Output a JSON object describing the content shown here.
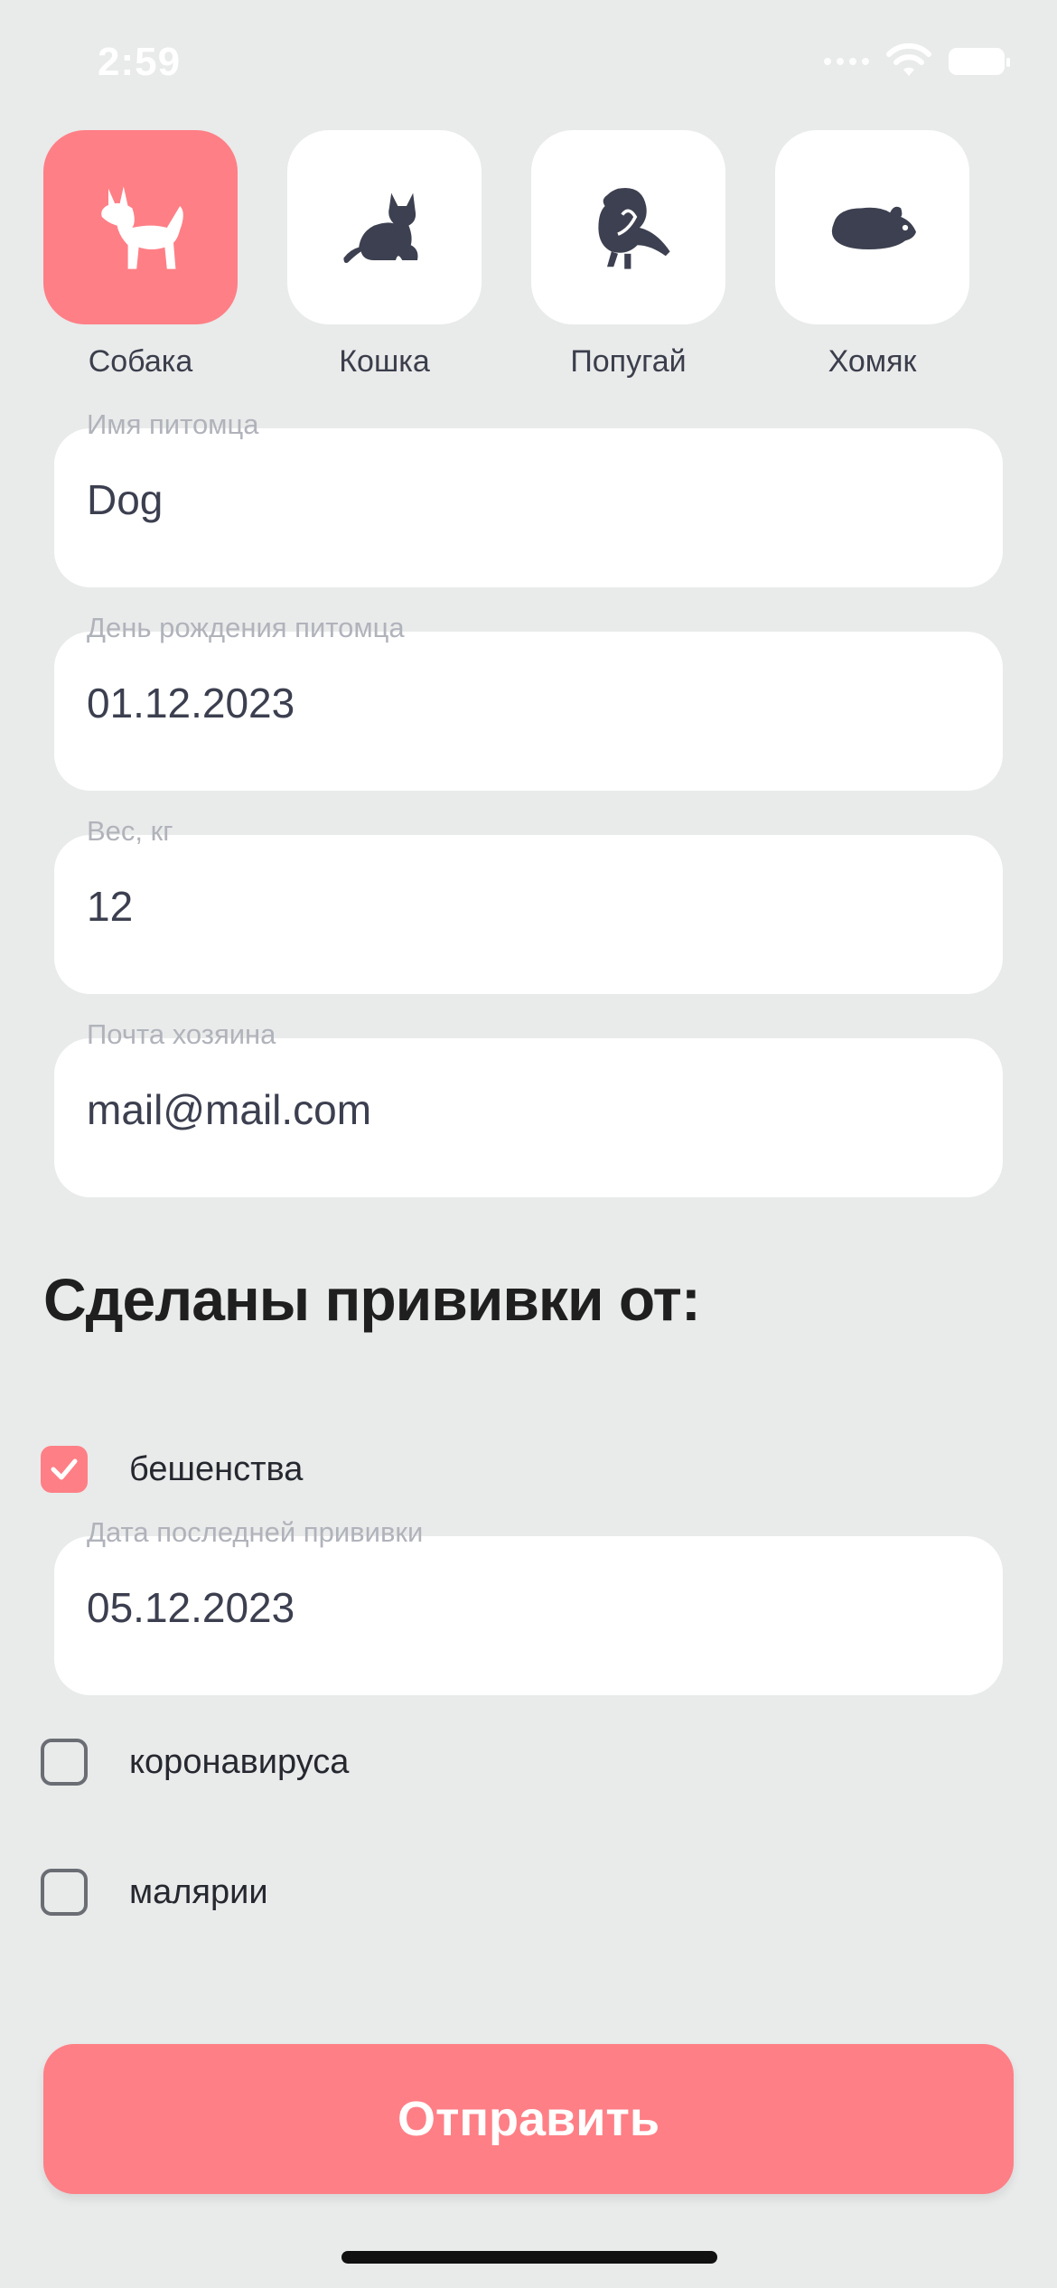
{
  "status_bar": {
    "time": "2:59"
  },
  "pets": [
    {
      "label": "Собака",
      "icon": "dog-icon",
      "selected": true
    },
    {
      "label": "Кошка",
      "icon": "cat-icon",
      "selected": false
    },
    {
      "label": "Попугай",
      "icon": "parrot-icon",
      "selected": false
    },
    {
      "label": "Хомяк",
      "icon": "hamster-icon",
      "selected": false
    }
  ],
  "fields": {
    "pet_name": {
      "label": "Имя питомца",
      "value": "Dog"
    },
    "birthday": {
      "label": "День рождения питомца",
      "value": "01.12.2023"
    },
    "weight": {
      "label": "Вес, кг",
      "value": "12"
    },
    "owner_email": {
      "label": "Почта хозяина",
      "value": "mail@mail.com"
    }
  },
  "vaccinations": {
    "title": "Сделаны прививки от:",
    "items": [
      {
        "label": "бешенства",
        "checked": true
      },
      {
        "label": "коронавируса",
        "checked": false
      },
      {
        "label": "малярии",
        "checked": false
      }
    ],
    "last_date": {
      "label": "Дата последней прививки",
      "value": "05.12.2023"
    }
  },
  "submit_label": "Отправить",
  "colors": {
    "accent": "#ff7f86",
    "background": "#e9eaea",
    "icon": "#3d4050",
    "label": "#b1b3bb"
  }
}
